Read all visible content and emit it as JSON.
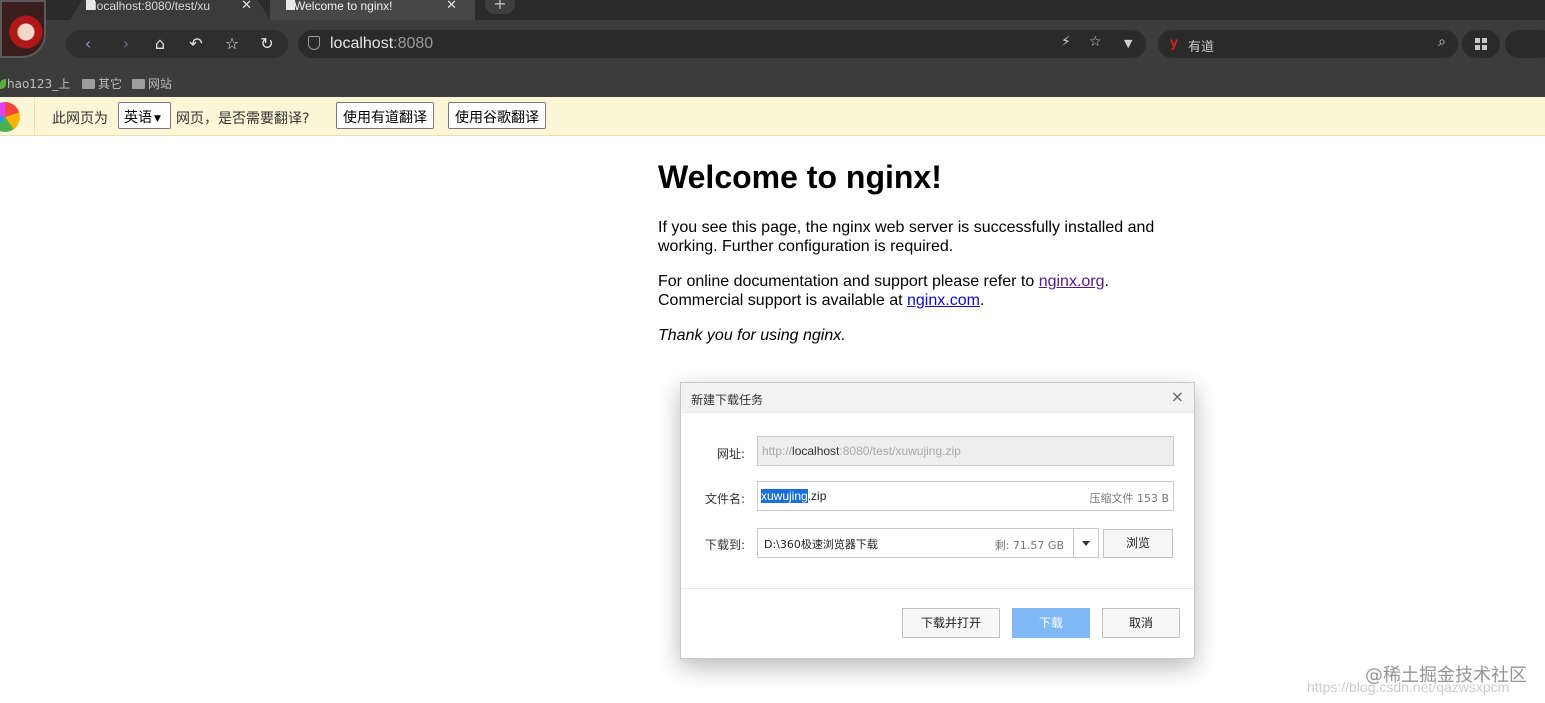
{
  "browser": {
    "tabs": [
      {
        "title": "localhost:8080/test/xu",
        "active": false
      },
      {
        "title": "Welcome to nginx!",
        "active": true
      }
    ],
    "new_tab_label": "+",
    "address": {
      "host": "localhost",
      "port": ":8080"
    },
    "search": {
      "engine_logo": "y",
      "engine": "有道"
    },
    "bookmarks": [
      "hao123_上",
      "其它",
      "网站"
    ]
  },
  "translate_bar": {
    "prefix": "此网页为",
    "language": "英语",
    "question": "网页，是否需要翻译?",
    "youdao_button": "使用有道翻译",
    "google_button": "使用谷歌翻译"
  },
  "page": {
    "heading": "Welcome to nginx!",
    "p1": "If you see this page, the nginx web server is successfully installed and working. Further configuration is required.",
    "p2_text1": "For online documentation and support please refer to ",
    "p2_link1": "nginx.org",
    "p2_text2": ".",
    "p2_text3": "Commercial support is available at ",
    "p2_link2": "nginx.com",
    "p2_text4": ".",
    "p3": "Thank you for using nginx."
  },
  "download_dialog": {
    "title": "新建下载任务",
    "close": "×",
    "url_label": "网址:",
    "url_prefix": "http://",
    "url_host": "localhost",
    "url_rest": ":8080/test/xuwujing.zip",
    "filename_label": "文件名:",
    "filename_selected": "xuwujing",
    "filename_ext": ".zip",
    "file_info": "压缩文件 153 B",
    "saveto_label": "下载到:",
    "save_path": "D:\\360极速浏览器下载",
    "free_space": "剩: 71.57 GB",
    "browse_button": "浏览",
    "download_open_button": "下载并打开",
    "download_button": "下载",
    "cancel_button": "取消"
  },
  "watermark": {
    "text": "@稀土掘金技术社区",
    "url": "https://blog.csdn.net/qazwsxpcm"
  },
  "colors": {
    "chrome_dark": "#3c3c3c",
    "translate_bar_bg": "#fdf6d6",
    "link": "#0b0bc8",
    "visited_link": "#551a8b",
    "primary_button": "#7fb8f5",
    "selection": "#1a6fd6"
  }
}
